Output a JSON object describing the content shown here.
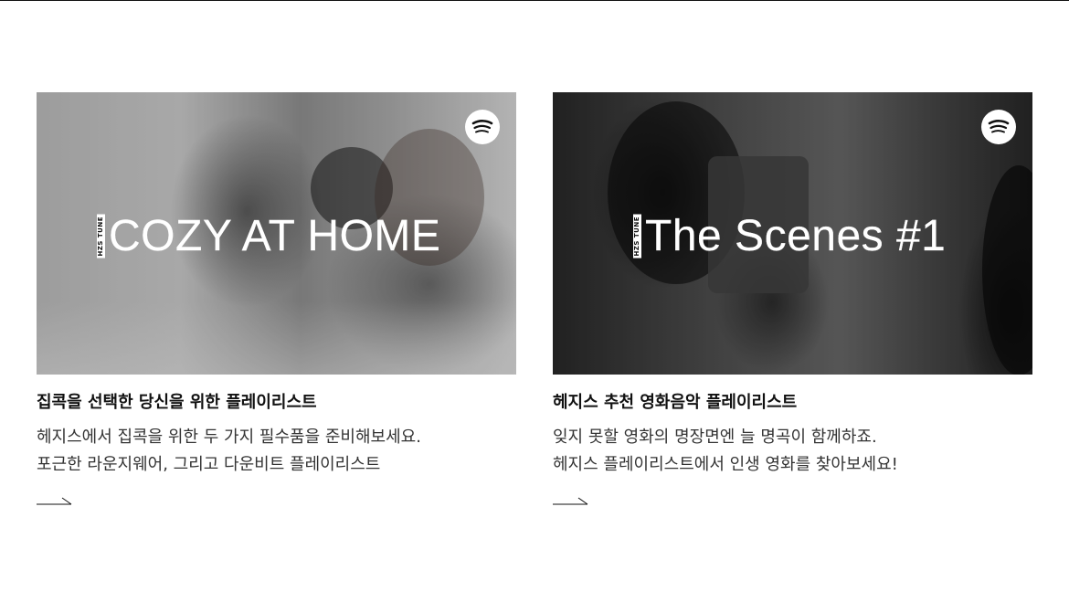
{
  "cards": [
    {
      "overlay_brand": "HZS TUNE",
      "overlay_title": "COZY AT HOME",
      "headline": "집콕을 선택한 당신을 위한 플레이리스트",
      "description_line1": "헤지스에서 집콕을 위한 두 가지 필수품을 준비해보세요.",
      "description_line2": "포근한 라운지웨어, 그리고 다운비트 플레이리스트",
      "icon": "spotify-icon",
      "link_icon": "arrow-right-icon"
    },
    {
      "overlay_brand": "HZS TUNE",
      "overlay_title": "The Scenes #1",
      "headline": "헤지스 추천 영화음악 플레이리스트",
      "description_line1": "잊지 못할 영화의 명장면엔 늘 명곡이 함께하죠.",
      "description_line2": "헤지스 플레이리스트에서 인생 영화를 찾아보세요!",
      "icon": "spotify-icon",
      "link_icon": "arrow-right-icon"
    }
  ],
  "colors": {
    "text_primary": "#111111",
    "text_secondary": "#333333",
    "spotify_badge_bg": "#ffffff",
    "spotify_mark": "#111111"
  }
}
